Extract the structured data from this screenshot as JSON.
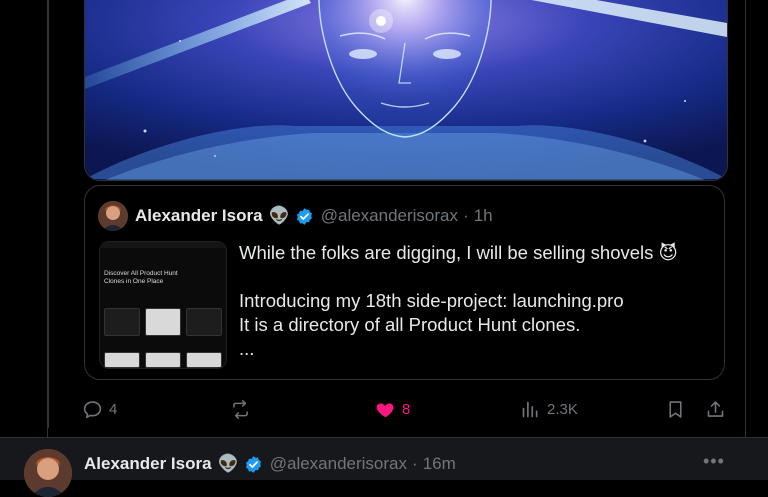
{
  "colors": {
    "background": "#000000",
    "accent_blue": "#1d9bf0",
    "like_pink": "#f91880",
    "muted": "#71767b",
    "text": "#e7e9ea"
  },
  "quoted_tweet": {
    "author_name": "Alexander Isora",
    "emoji": "👽",
    "handle": "@alexanderisorax",
    "separator": "·",
    "time": "1h",
    "thumbnail_title": "Discover All Product Hunt Clones in One Place",
    "text_line1": "While the folks are digging, I will be selling shovels 😈",
    "text_line2": "Introducing my 18th side-project: launching.pro",
    "text_line3": "It is a directory of all Product Hunt clones.",
    "text_line4": "..."
  },
  "actions": {
    "reply_icon": "reply-icon",
    "reply_count": "4",
    "retweet_icon": "retweet-icon",
    "retweet_count": "",
    "like_icon": "heart-filled-icon",
    "like_count": "8",
    "views_icon": "views-icon",
    "views_count": "2.3K",
    "bookmark_icon": "bookmark-icon",
    "share_icon": "share-icon"
  },
  "next_tweet": {
    "author_name": "Alexander Isora",
    "emoji": "👽",
    "handle": "@alexanderisorax",
    "separator": "·",
    "time": "16m",
    "more_label": "•••"
  }
}
